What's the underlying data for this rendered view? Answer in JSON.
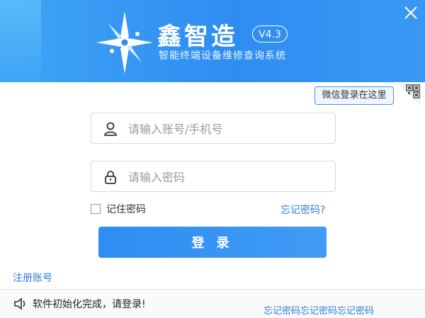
{
  "header": {
    "brand_name": "鑫智造",
    "version": "V4.3",
    "tagline": "智能终端设备维修查询系统"
  },
  "wechat_tip": "微信登录在这里",
  "login_form": {
    "account_placeholder": "请输入账号/手机号",
    "password_placeholder": "请输入密码",
    "remember_label": "记住密码",
    "forgot_label": "忘记密码?",
    "login_button": "登 录",
    "register_link": "注册账号"
  },
  "status": {
    "message": "软件初始化完成，请登录!",
    "links_text": "忘记密码忘记密码忘记密码"
  },
  "colors": {
    "header_blue": "#2f8df2",
    "link_blue": "#2f7fd8",
    "button_blue": "#3f9bf5"
  },
  "icons": [
    "logo-icon",
    "close-icon",
    "qr-code-icon",
    "user-icon",
    "lock-icon",
    "speaker-icon"
  ]
}
